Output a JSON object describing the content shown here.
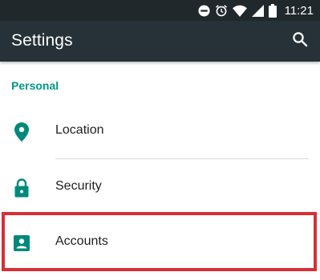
{
  "status_bar": {
    "time": "11:21",
    "icons": [
      "do-not-disturb-icon",
      "alarm-icon",
      "wifi-icon",
      "signal-icon",
      "battery-icon"
    ]
  },
  "app_bar": {
    "title": "Settings",
    "search_icon": "search-icon"
  },
  "section": {
    "title": "Personal"
  },
  "items": [
    {
      "label": "Location",
      "icon": "location-pin-icon"
    },
    {
      "label": "Security",
      "icon": "lock-icon"
    },
    {
      "label": "Accounts",
      "icon": "account-box-icon"
    }
  ],
  "colors": {
    "status_bar": "#20282b",
    "app_bar": "#263238",
    "accent": "#009688",
    "highlight": "#d62f35"
  }
}
